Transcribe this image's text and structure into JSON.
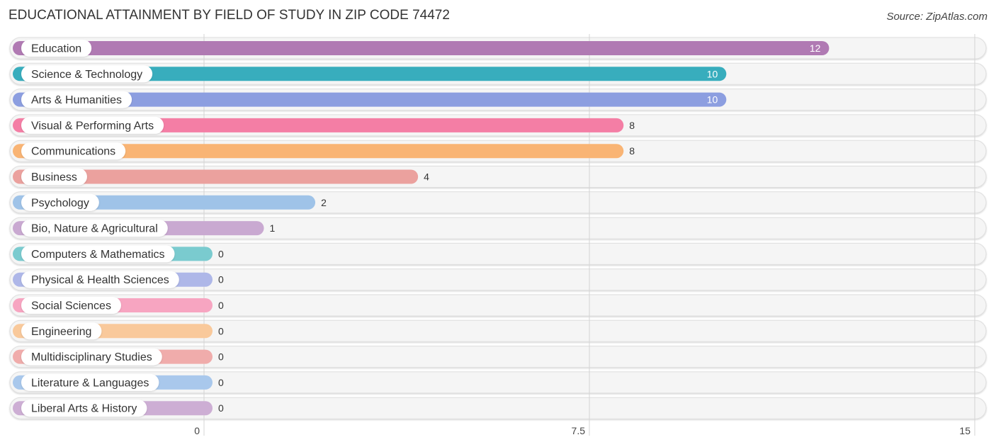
{
  "header": {
    "title": "EDUCATIONAL ATTAINMENT BY FIELD OF STUDY IN ZIP CODE 74472",
    "source": "Source: ZipAtlas.com"
  },
  "chart_data": {
    "type": "bar",
    "orientation": "horizontal",
    "title": "EDUCATIONAL ATTAINMENT BY FIELD OF STUDY IN ZIP CODE 74472",
    "xlabel": "",
    "ylabel": "",
    "xlim": [
      0,
      15
    ],
    "xticks": [
      0,
      7.5,
      15
    ],
    "xtick_labels": [
      "0",
      "7.5",
      "15"
    ],
    "grid": true,
    "categories": [
      "Education",
      "Science & Technology",
      "Arts & Humanities",
      "Visual & Performing Arts",
      "Communications",
      "Business",
      "Psychology",
      "Bio, Nature & Agricultural",
      "Computers & Mathematics",
      "Physical & Health Sciences",
      "Social Sciences",
      "Engineering",
      "Multidisciplinary Studies",
      "Literature & Languages",
      "Liberal Arts & History"
    ],
    "values": [
      12,
      10,
      10,
      8,
      8,
      4,
      2,
      1,
      0,
      0,
      0,
      0,
      0,
      0,
      0
    ],
    "value_labels": [
      "12",
      "10",
      "10",
      "8",
      "8",
      "4",
      "2",
      "1",
      "0",
      "0",
      "0",
      "0",
      "0",
      "0",
      "0"
    ],
    "colors": [
      "#b07ab3",
      "#38adbd",
      "#8c9ee0",
      "#f47ea5",
      "#f9b474",
      "#eba19e",
      "#9fc3e8",
      "#c9a9d1",
      "#7acbcf",
      "#aeb7e8",
      "#f7a5c1",
      "#f9c99b",
      "#f0acab",
      "#a9c8ec",
      "#cdaed4"
    ]
  }
}
